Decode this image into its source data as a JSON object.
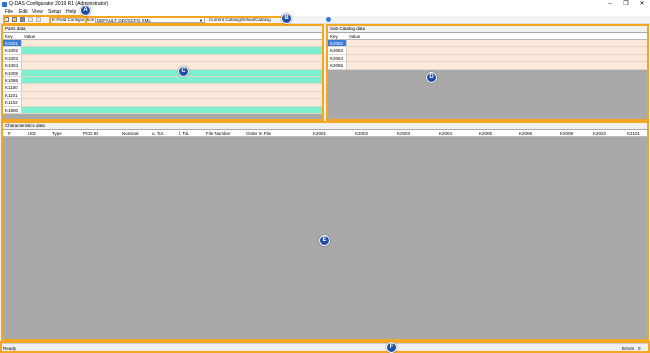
{
  "window": {
    "title": "Q-DAS Configurator 2019 R1 (Administrator)",
    "minimize_glyph": "–",
    "maximize_glyph": "❐",
    "close_glyph": "✕"
  },
  "menu": [
    "File",
    "Edit",
    "View",
    "Setup",
    "Help"
  ],
  "toolbar": {
    "config_label": "K-Field Configuration",
    "config_value": "DEFAULT QDVSCFG XML",
    "catalog_label": "Current Catalog",
    "catalog_value": "DefaultCatalog"
  },
  "parts": {
    "title": "Parts data",
    "columns": [
      "Key",
      "Value"
    ],
    "rows": [
      {
        "key": "K1001",
        "tint": "selected"
      },
      {
        "key": "K1002",
        "tint": "teal"
      },
      {
        "key": "K1003",
        "tint": "peach"
      },
      {
        "key": "K1004",
        "tint": "peach"
      },
      {
        "key": "K1005",
        "tint": "teal"
      },
      {
        "key": "K1086",
        "tint": "teal"
      },
      {
        "key": "K1100",
        "tint": "peach"
      },
      {
        "key": "K1101",
        "tint": "peach"
      },
      {
        "key": "K1102",
        "tint": "peach"
      },
      {
        "key": "K1900",
        "tint": "teal"
      }
    ]
  },
  "subcatalog": {
    "title": "Sub-Catalog data",
    "columns": [
      "Key",
      "Value"
    ],
    "rows": [
      {
        "key": "K2062",
        "tint": "selected"
      },
      {
        "key": "K2063",
        "tint": "peach"
      },
      {
        "key": "K2064",
        "tint": "peach"
      },
      {
        "key": "K2065",
        "tint": "peach"
      }
    ]
  },
  "characteristics": {
    "title": "Characteristics data",
    "columns": [
      "#",
      "UID",
      "Type",
      "PCD ID",
      "Nominal",
      "u. Tol.",
      "l. Tol.",
      "File Number",
      "Order In File",
      "K2001",
      "K2002",
      "K2003",
      "K2004",
      "K2005",
      "K2006",
      "K2009",
      "K2022",
      "K2101"
    ]
  },
  "status": {
    "left": "Ready",
    "errors_label": "Errors",
    "errors_value": "0"
  },
  "markers": [
    "A",
    "B",
    "C",
    "D",
    "E",
    "F"
  ],
  "colors": {
    "highlight": "#f5a623",
    "teal_row": "#7ef0d0",
    "peach_row": "#fde9d9",
    "selected_row": "#3a7bd5",
    "marker": "#1f4fa3",
    "grid_empty": "#a9a9a9"
  }
}
